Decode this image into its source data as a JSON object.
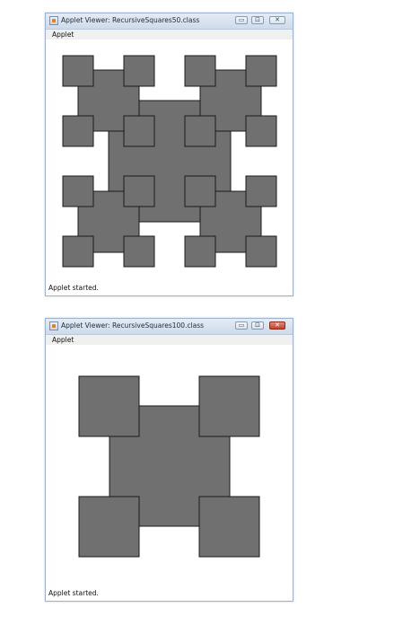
{
  "window1": {
    "title": "Applet Viewer: RecursiveSquares50.class",
    "menu_label": "Applet",
    "status": "Applet started."
  },
  "window2": {
    "title": "Applet Viewer: RecursiveSquares100.class",
    "menu_label": "Applet",
    "status": "Applet started."
  },
  "controls": {
    "minimize_glyph": "▭",
    "maximize_glyph": "⊡",
    "close_glyph": "✕"
  },
  "colors": {
    "square_fill": "#707070",
    "square_stroke": "#1a1a1a",
    "titlebar": "#d6e1ee",
    "close_active": "#c6412a"
  }
}
